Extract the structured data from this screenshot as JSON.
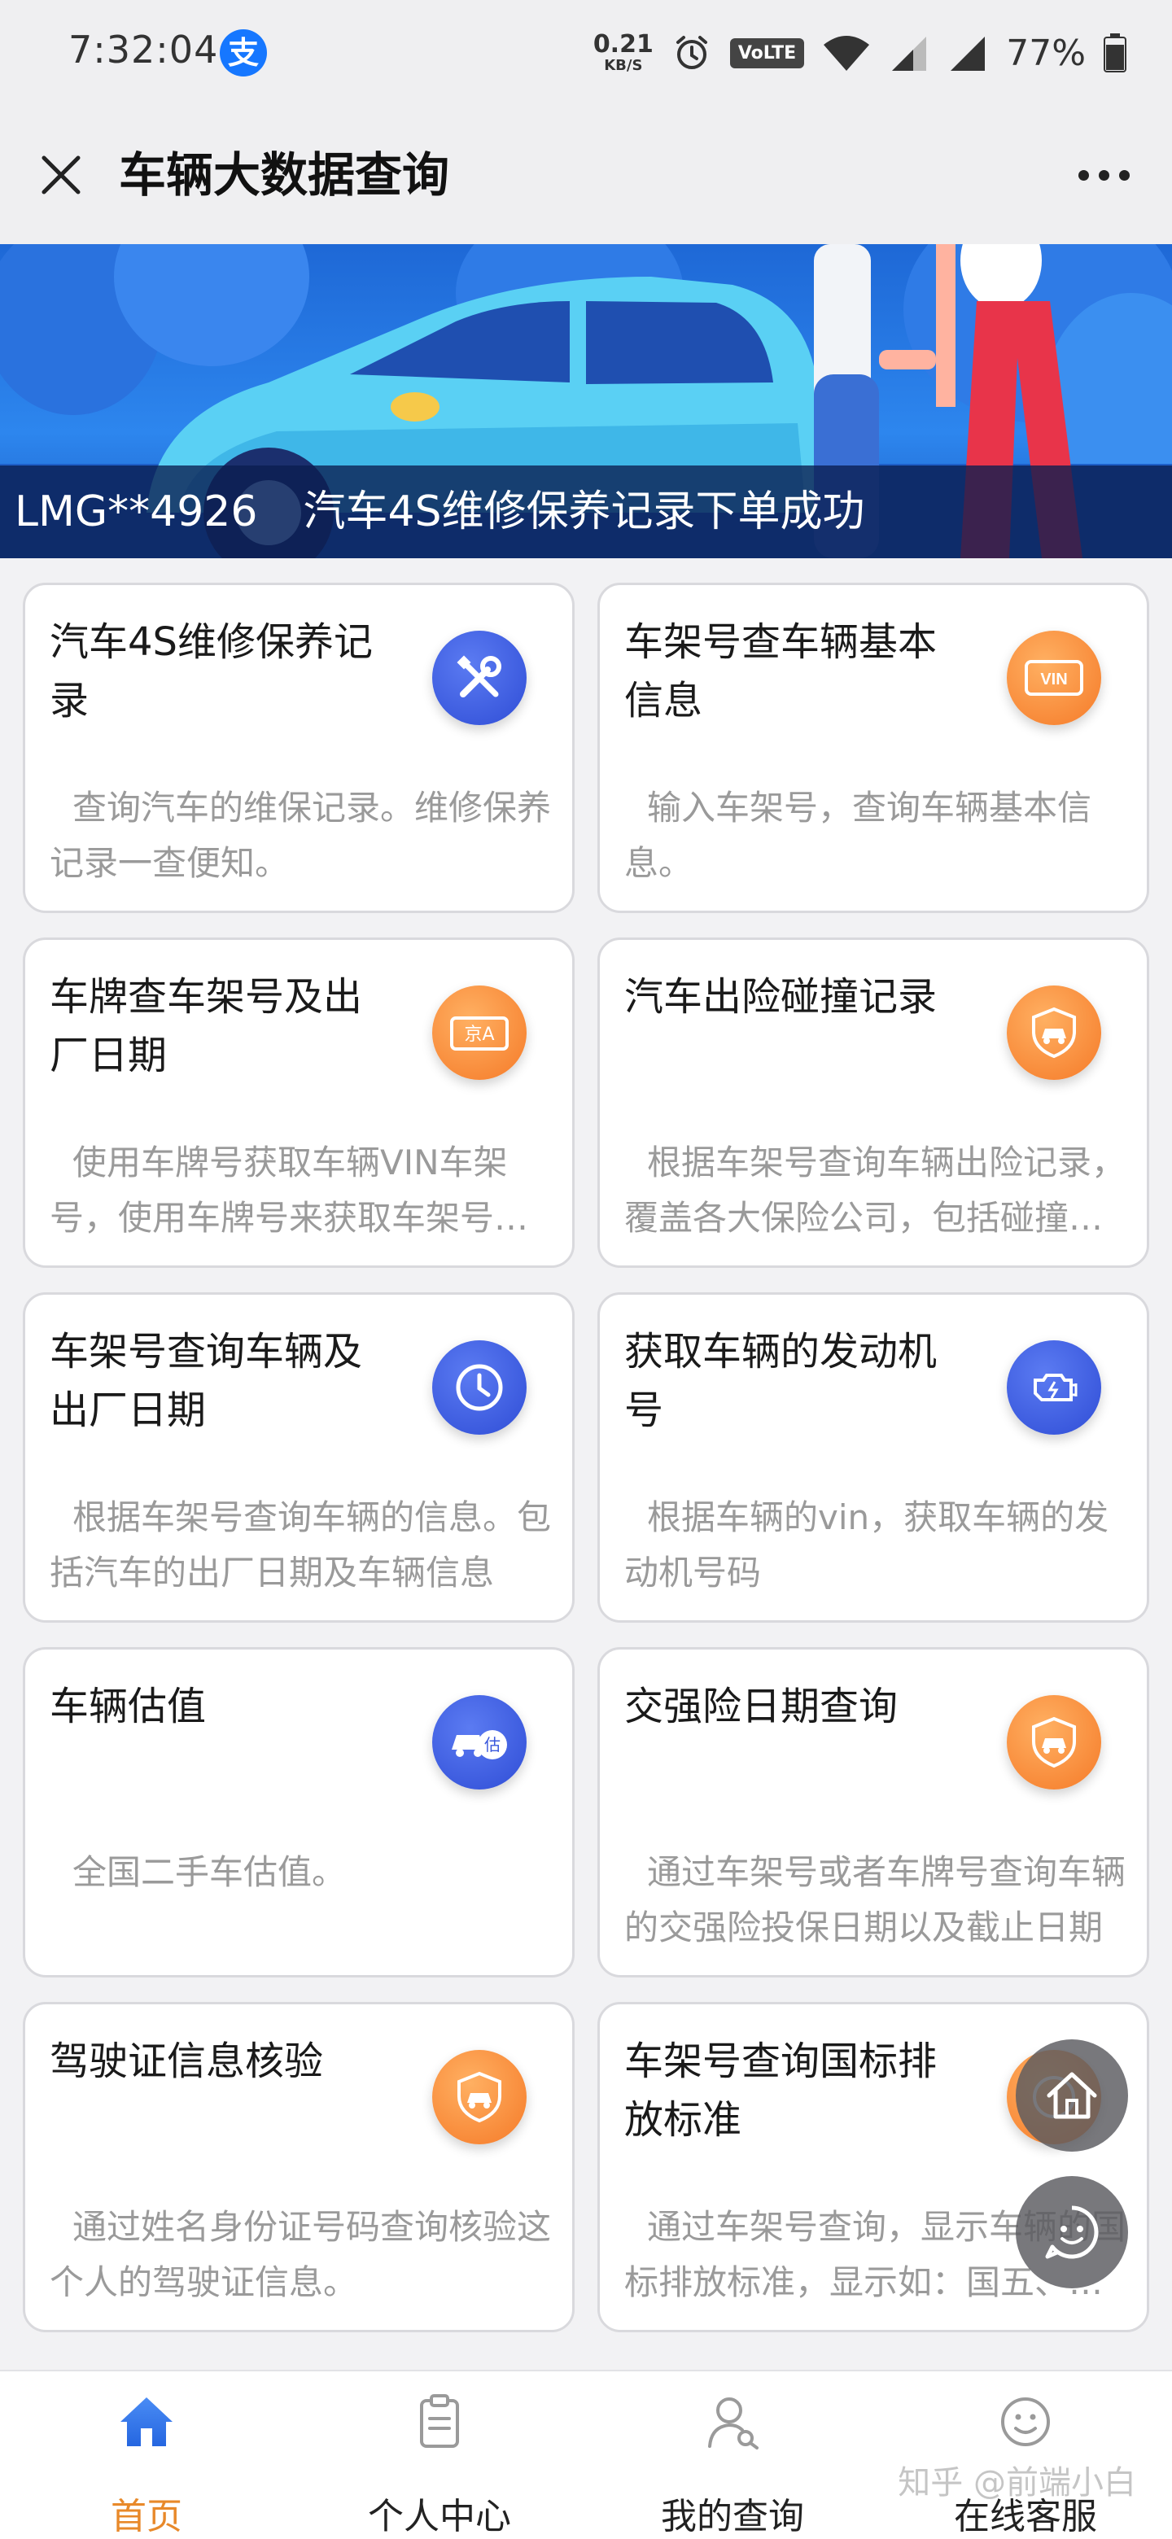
{
  "status_bar": {
    "time": "7:32:04",
    "app_badge": "支",
    "net_speed": "0.21",
    "net_unit": "KB/S",
    "volte": "VoLTE",
    "battery": "77%"
  },
  "header": {
    "title": "车辆大数据查询"
  },
  "banner": {
    "plate": "LMG**4926",
    "message": "汽车4S维修保养记录下单成功"
  },
  "cards": [
    {
      "title": "汽车4S维修保养记录",
      "desc": "查询汽车的维保记录。维修保养记录一查便知。",
      "icon": "wrench-screwdriver-icon",
      "color": "#3a58dc"
    },
    {
      "title": "车架号查车辆基本信息",
      "desc": "输入车架号，查询车辆基本信息。",
      "icon": "vin-icon",
      "color": "#f5842e"
    },
    {
      "title": "车牌查车架号及出厂日期",
      "desc": "使用车牌号获取车辆VIN车架号，使用车牌号来获取车架号及出厂日期",
      "icon": "license-plate-icon",
      "color": "#f5842e"
    },
    {
      "title": "汽车出险碰撞记录",
      "desc": "根据车架号查询车辆出险记录，覆盖各大保险公司，包括碰撞记录",
      "icon": "car-shield-icon",
      "color": "#f5842e"
    },
    {
      "title": "车架号查询车辆及出厂日期",
      "desc": "根据车架号查询车辆的信息。包括汽车的出厂日期及车辆信息",
      "icon": "clock-icon",
      "color": "#3a58dc"
    },
    {
      "title": "获取车辆的发动机号",
      "desc": "根据车辆的vin，获取车辆的发动机号码",
      "icon": "engine-icon",
      "color": "#3a58dc"
    },
    {
      "title": "车辆估值",
      "desc": "全国二手车估值。",
      "icon": "car-valuation-icon",
      "color": "#3a58dc"
    },
    {
      "title": "交强险日期查询",
      "desc": "通过车架号或者车牌号查询车辆的交强险投保日期以及截止日期",
      "icon": "car-shield-icon",
      "color": "#f5842e"
    },
    {
      "title": "驾驶证信息核验",
      "desc": "通过姓名身份证号码查询核验这个人的驾驶证信息。",
      "icon": "car-shield-icon",
      "color": "#f5842e"
    },
    {
      "title": "车架号查询国标排放标准",
      "desc": "通过车架号查询，显示车辆的国标排放标准，显示如：国五、国六",
      "icon": "emission-icon",
      "color": "#f5842e"
    }
  ],
  "plate_icon_text": "京A",
  "vin_icon_text": "VIN",
  "valuation_icon_text": "估",
  "nav": [
    {
      "label": "首页",
      "icon": "home-icon",
      "active": true
    },
    {
      "label": "个人中心",
      "icon": "clipboard-icon",
      "active": false
    },
    {
      "label": "我的查询",
      "icon": "user-search-icon",
      "active": false
    },
    {
      "label": "在线客服",
      "icon": "smiley-icon",
      "active": false
    }
  ],
  "watermark": "知乎 @前端小白",
  "colors": {
    "accent_orange": "#e8892a",
    "accent_blue": "#3a58dc"
  }
}
